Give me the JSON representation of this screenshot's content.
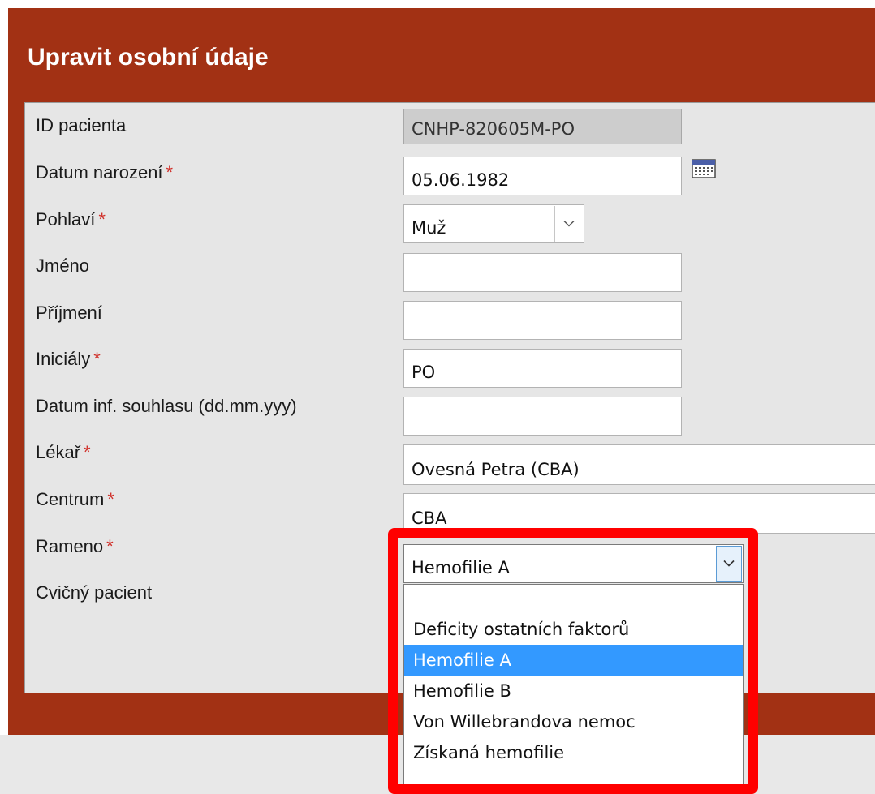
{
  "title": "Upravit osobní údaje",
  "required_marker": "*",
  "fields": {
    "patient_id": {
      "label": "ID pacienta",
      "value": "CNHP-820605M-PO"
    },
    "birth_date": {
      "label": "Datum narození",
      "value": "05.06.1982"
    },
    "sex": {
      "label": "Pohlaví",
      "value": "Muž"
    },
    "first_name": {
      "label": "Jméno",
      "value": ""
    },
    "last_name": {
      "label": "Příjmení",
      "value": ""
    },
    "initials": {
      "label": "Iniciály",
      "value": "PO"
    },
    "consent_date": {
      "label": "Datum inf. souhlasu (dd.mm.yyy)",
      "value": ""
    },
    "doctor": {
      "label": "Lékař",
      "value": "Ovesná Petra (CBA)"
    },
    "center": {
      "label": "Centrum",
      "value": "CBA"
    },
    "arm": {
      "label": "Rameno",
      "value": "Hemofilie A"
    },
    "training_patient": {
      "label": "Cvičný pacient"
    }
  },
  "arm_options": [
    "",
    "Deficity ostatních faktorů",
    "Hemofilie A",
    "Hemofilie B",
    "Von Willebrandova nemoc",
    "Získaná hemofilie"
  ],
  "arm_selected_index": 2,
  "icons": {
    "calendar": "calendar-icon",
    "dropdown": "chevron-down-icon"
  },
  "colors": {
    "header": "#a23114",
    "form_bg": "#e6e6e6",
    "selection": "#3399ff",
    "highlight": "#ff0000",
    "required": "#d0302a"
  }
}
